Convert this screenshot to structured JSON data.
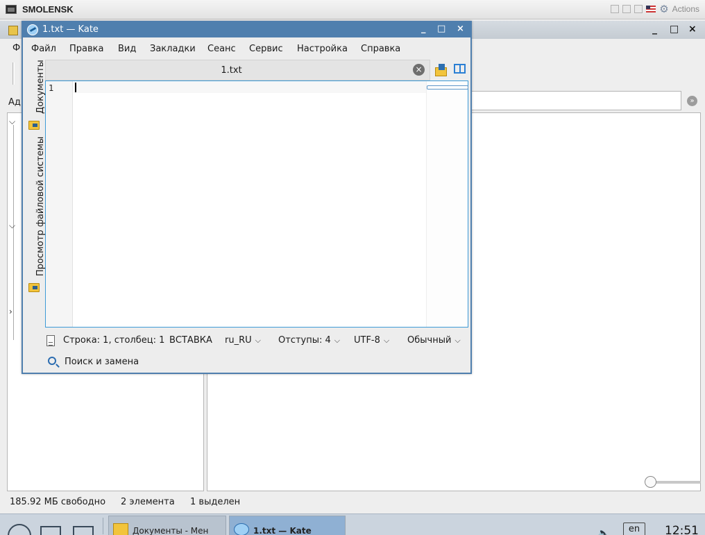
{
  "vm": {
    "title": "SMOLENSK",
    "actions_label": "Actions"
  },
  "file_manager": {
    "menu_fragment": "Ф",
    "address_fragment": "Ад",
    "window_controls": {
      "minimize": "_",
      "maximize": "□",
      "close": "×"
    },
    "status": {
      "free_space": "185.92 МБ свободно",
      "elements": "2 элемента",
      "selected": "1 выделен"
    }
  },
  "kate": {
    "window_title": "1.txt  — Kate",
    "window_controls": {
      "minimize": "_",
      "maximize": "□",
      "close": "×"
    },
    "menu": [
      "Файл",
      "Правка",
      "Вид",
      "Закладки",
      "Сеанс",
      "Сервис",
      "Настройка",
      "Справка"
    ],
    "sidebar": {
      "documents_label": "Документы",
      "filesystem_label": "Просмотр файловой системы"
    },
    "tab": {
      "label": "1.txt",
      "close": "×"
    },
    "editor": {
      "line_numbers": [
        "1"
      ],
      "content": ""
    },
    "statusbar": {
      "position": "Строка: 1, столбец: 1",
      "mode": "ВСТАВКА",
      "dictionary": "ru_RU",
      "indent": "Отступы: 4",
      "encoding": "UTF-8",
      "syntax": "Обычный"
    },
    "search_replace_label": "Поиск и замена"
  },
  "taskbar": {
    "tasks": [
      {
        "label": "Документы - Мен"
      },
      {
        "label": "1.txt — Kate"
      }
    ],
    "language": "en",
    "clock": "12:51"
  },
  "colors": {
    "kate_titlebar": "#4f7fae",
    "editor_focus_border": "#3d9ad6",
    "taskbar": "#cbd4de"
  }
}
